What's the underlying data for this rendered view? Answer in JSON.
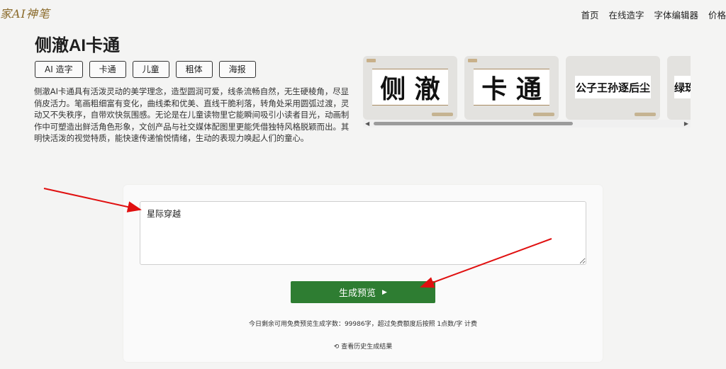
{
  "header": {
    "logo": "家AI神笔",
    "nav": [
      "首页",
      "在线造字",
      "字体编辑器",
      "价格"
    ]
  },
  "page": {
    "title": "侧澈AI卡通",
    "tags": [
      "AI 造字",
      "卡通",
      "儿童",
      "粗体",
      "海报"
    ],
    "description": "侧澈AI卡通具有活泼灵动的美学理念，造型圆润可爱，线条流畅自然，无生硬棱角，尽显俏皮活力。笔画粗细富有变化，曲线柔和优美、直线干脆利落，转角处采用圆弧过渡，灵动又不失秩序，自带欢快氛围感。无论是在儿童读物里它能瞬间吸引小读者目光，动画制作中可塑造出鲜活角色形象，文创产品与社交媒体配图里更能凭借独特风格脱颖而出。其明快活泼的视觉特质，能快速传递愉悦情绪，生动的表现力唤起人们的童心。"
  },
  "previews": [
    {
      "text": "侧 澈"
    },
    {
      "text": "卡 通"
    },
    {
      "text": "公子王孙逐后尘"
    },
    {
      "text": "绿珠"
    }
  ],
  "editor": {
    "input_value": "星际穿越",
    "generate_label": "生成预览",
    "generate_icon": "play-triangle-icon",
    "quota_text": "今日剩余可用免费预览生成字数：99986字，超过免费额度后按照 1点数/字 计费",
    "history_label": "查看历史生成结果",
    "history_icon": "history-icon"
  },
  "colors": {
    "accent": "#2e7d32",
    "annotation": "#e01010"
  }
}
